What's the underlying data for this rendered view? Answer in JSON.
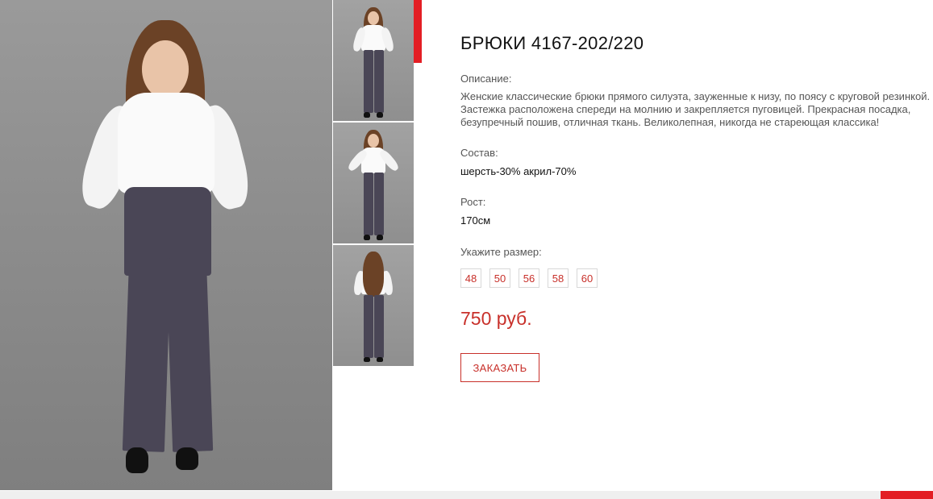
{
  "product": {
    "title": "БРЮКИ 4167-202/220",
    "description_label": "Описание:",
    "description": "Женские классические брюки прямого силуэта, зауженные к низу, по поясу с круговой резинкой. Застежка расположена спереди на молнию и закрепляется пуговицей. Прекрасная посадка, безупречный пошив, отличная ткань. Великолепная, никогда не стареющая классика!",
    "composition_label": "Состав:",
    "composition": "шерсть-30% акрил-70%",
    "height_label": "Рост:",
    "height": "170см",
    "size_label": "Укажите размер:",
    "sizes": [
      "48",
      "50",
      "56",
      "58",
      "60"
    ],
    "price": "750 руб.",
    "order_button": "ЗАКАЗАТЬ"
  },
  "gallery": {
    "thumbnails": [
      "front-view",
      "front-view-full",
      "back-view"
    ],
    "active_thumbnail": 0
  },
  "colors": {
    "accent": "#e31e24",
    "price": "#c8302a",
    "pants": "#4a4656",
    "background_photo": "#8f8f8f"
  }
}
